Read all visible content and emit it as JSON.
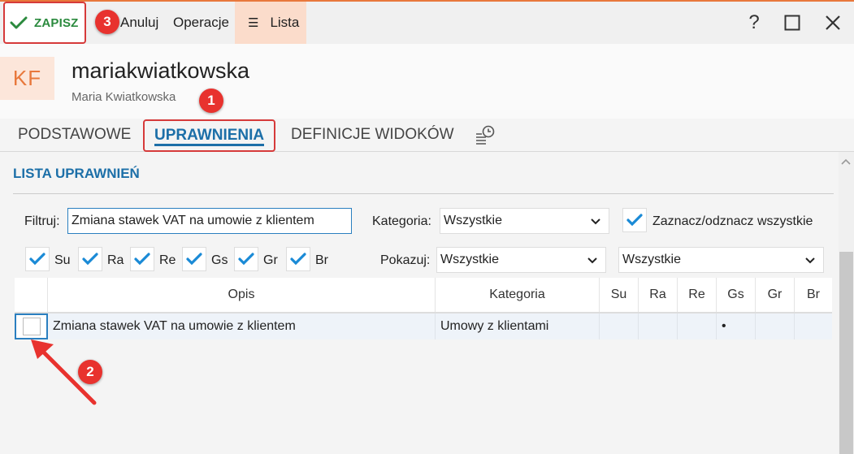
{
  "toolbar": {
    "save_label": "ZAPISZ",
    "cancel_label": "Anuluj",
    "operations_label": "Operacje",
    "list_label": "Lista",
    "help_label": "?"
  },
  "user": {
    "initials": "KF",
    "username": "mariakwiatkowska",
    "full_name": "Maria Kwiatkowska"
  },
  "tabs": [
    {
      "label": "PODSTAWOWE"
    },
    {
      "label": "UPRAWNIENIA",
      "active": true
    },
    {
      "label": "DEFINICJE WIDOKÓW"
    }
  ],
  "section": {
    "title": "LISTA UPRAWNIEŃ"
  },
  "filters": {
    "filter_label": "Filtruj:",
    "filter_value": "Zmiana stawek VAT na umowie z klientem",
    "category_label": "Kategoria:",
    "category_value": "Wszystkie",
    "toggle_all_label": "Zaznacz/odznacz wszystkie",
    "show_label": "Pokazuj:",
    "show_value": "Wszystkie",
    "show_value_2": "Wszystkie",
    "permission_checks": [
      {
        "label": "Su",
        "checked": true
      },
      {
        "label": "Ra",
        "checked": true
      },
      {
        "label": "Re",
        "checked": true
      },
      {
        "label": "Gs",
        "checked": true
      },
      {
        "label": "Gr",
        "checked": true
      },
      {
        "label": "Br",
        "checked": true
      }
    ]
  },
  "grid": {
    "columns": [
      "Opis",
      "Kategoria",
      "Su",
      "Ra",
      "Re",
      "Gs",
      "Gr",
      "Br"
    ],
    "rows": [
      {
        "opis": "Zmiana stawek VAT na umowie z klientem",
        "kategoria": "Umowy z klientami",
        "su": "",
        "ra": "",
        "re": "",
        "gs": "•",
        "gr": "",
        "br": ""
      }
    ]
  },
  "annotations": {
    "badge1": "1",
    "badge2": "2",
    "badge3": "3"
  },
  "colors": {
    "accent": "#e8783c",
    "blue": "#1c6fa8",
    "highlight": "#d63a3a",
    "green": "#2b8a3e"
  }
}
